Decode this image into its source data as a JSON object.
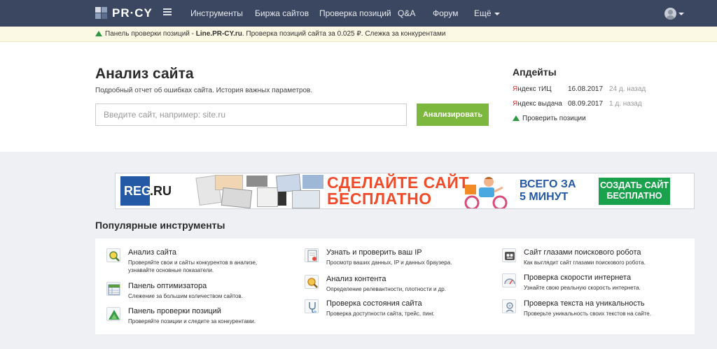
{
  "nav": {
    "logo": "PR·CY",
    "items": [
      "Инструменты",
      "Биржа сайтов",
      "Проверка позиций",
      "Q&A",
      "Форум",
      "Ещё"
    ]
  },
  "promo": {
    "prefix": "Панель проверки позиций - ",
    "bold": "Line.PR-CY.ru",
    "suffix": ". Проверка позиций сайта за 0.025 ₽. Слежка за конкурентами"
  },
  "hero": {
    "title": "Анализ сайта",
    "subtitle": "Подробный отчет об ошибках сайта. История важных параметров.",
    "search_placeholder": "Введите сайт, например: site.ru",
    "button": "Анализировать"
  },
  "updates": {
    "title": "Апдейты",
    "rows": [
      {
        "brand": "Я",
        "label": "ндекс тИЦ",
        "date": "16.08.2017",
        "ago": "24 д. назад"
      },
      {
        "brand": "Я",
        "label": "ндекс выдача",
        "date": "08.09.2017",
        "ago": "1 д. назад"
      }
    ],
    "link": "Проверить позиции"
  },
  "banner": {
    "logo": "REG",
    "logo_suffix": ".RU",
    "headline1": "СДЕЛАЙТЕ САЙТ",
    "headline2": "БЕСПЛАТНО",
    "mid1": "ВСЕГО ЗА",
    "mid2": "5 МИНУТ",
    "cta": "СОЗДАТЬ САЙТ БЕСПЛАТНО"
  },
  "tools": {
    "title": "Популярные инструменты",
    "items": [
      {
        "name": "Анализ сайта",
        "desc1": "Проверяйте свои и сайты конкурентов в анализе,",
        "desc2": "узнавайте основные показатели.",
        "icon": "magnifier-icon"
      },
      {
        "name": "Панель оптимизатора",
        "desc1": "Слежение за большим количеством сайтов.",
        "desc2": "",
        "icon": "table-icon"
      },
      {
        "name": "Панель проверки позиций",
        "desc1": "Проверяйте позиции и следите за конкурентами.",
        "desc2": "",
        "icon": "positions-icon"
      },
      {
        "name": "Узнать и проверить ваш IP",
        "desc1": "Просмотр ваших данных, IP и данных браузера.",
        "desc2": "",
        "icon": "ip-document-icon"
      },
      {
        "name": "Анализ контента",
        "desc1": "Определение релевантности, плотности и др.",
        "desc2": "",
        "icon": "content-magnifier-icon"
      },
      {
        "name": "Проверка состояния сайта",
        "desc1": "Проверка доступности сайта, трейс, пинг.",
        "desc2": "",
        "icon": "stethoscope-icon"
      },
      {
        "name": "Сайт глазами поискового робота",
        "desc1": "Как выглядит сайт глазами поискового робота.",
        "desc2": "",
        "icon": "robot-icon"
      },
      {
        "name": "Проверка скорости интернета",
        "desc1": "Узнайте свою реальную скорость интернета.",
        "desc2": "",
        "icon": "speedometer-icon"
      },
      {
        "name": "Проверка текста на уникальность",
        "desc1": "Проверьте уникальность своих текстов на сайте.",
        "desc2": "",
        "icon": "uniqueness-icon"
      }
    ]
  },
  "colors": {
    "nav_bg": "#3b4760",
    "accent_green": "#7cb83d",
    "yandex_red": "#e62d2d",
    "promo_bg": "#fbf8e3"
  }
}
